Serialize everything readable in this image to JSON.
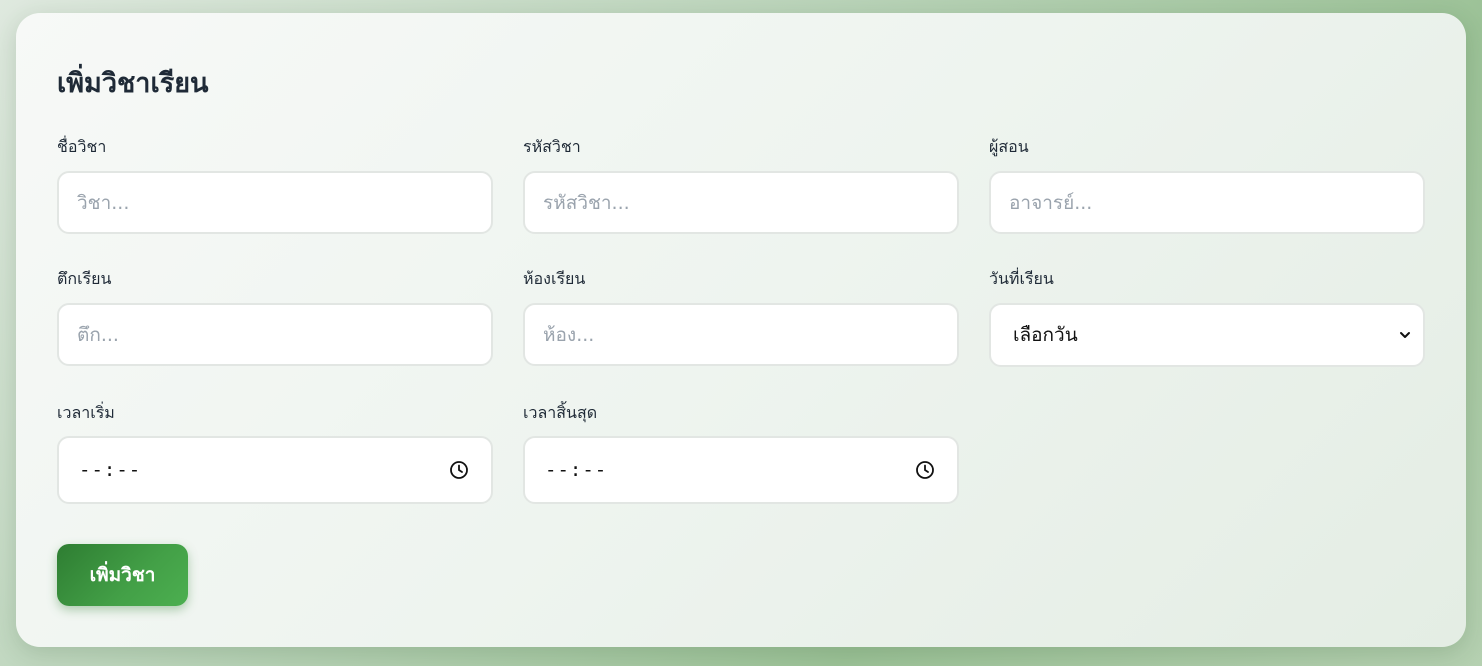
{
  "form": {
    "title": "เพิ่มวิชาเรียน",
    "submit_label": "เพิ่มวิชา"
  },
  "fields": {
    "subject_name": {
      "label": "ชื่อวิชา",
      "placeholder": "วิชา...",
      "value": ""
    },
    "subject_code": {
      "label": "รหัสวิชา",
      "placeholder": "รหัสวิชา...",
      "value": ""
    },
    "instructor": {
      "label": "ผู้สอน",
      "placeholder": "อาจารย์...",
      "value": ""
    },
    "building": {
      "label": "ตึกเรียน",
      "placeholder": "ตึก...",
      "value": ""
    },
    "room": {
      "label": "ห้องเรียน",
      "placeholder": "ห้อง...",
      "value": ""
    },
    "study_day": {
      "label": "วันที่เรียน",
      "selected": "เลือกวัน"
    },
    "start_time": {
      "label": "เวลาเริ่ม",
      "value": "--:--"
    },
    "end_time": {
      "label": "เวลาสิ้นสุด",
      "value": "--:--"
    }
  },
  "icons": {
    "select_arrow": "chevron-down-icon",
    "time_picker": "clock-icon"
  },
  "colors": {
    "accent": "#43a047",
    "accent_dark": "#2e7d32",
    "text": "#1f2a37",
    "placeholder": "#9aa3ad",
    "input_border": "#e2e6e3"
  }
}
